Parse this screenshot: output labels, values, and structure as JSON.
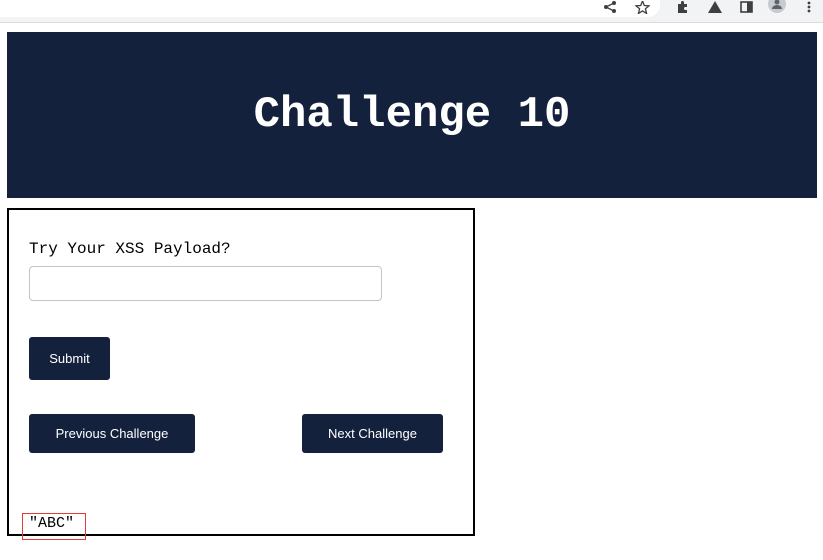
{
  "browser": {
    "icons": [
      "share-icon",
      "star-icon",
      "extensions-icon",
      "profile-shortcut-icon",
      "side-panel-icon",
      "avatar",
      "kebab-menu-icon"
    ]
  },
  "header": {
    "title": "Challenge 10",
    "background_color": "#14213d"
  },
  "form": {
    "label": "Try Your XSS Payload?",
    "input_value": "",
    "input_placeholder": "",
    "submit_label": "Submit"
  },
  "navigation": {
    "previous_label": "Previous Challenge",
    "next_label": "Next Challenge"
  },
  "output": {
    "text": "\"ABC\"",
    "highlight_color": "#e53935"
  }
}
